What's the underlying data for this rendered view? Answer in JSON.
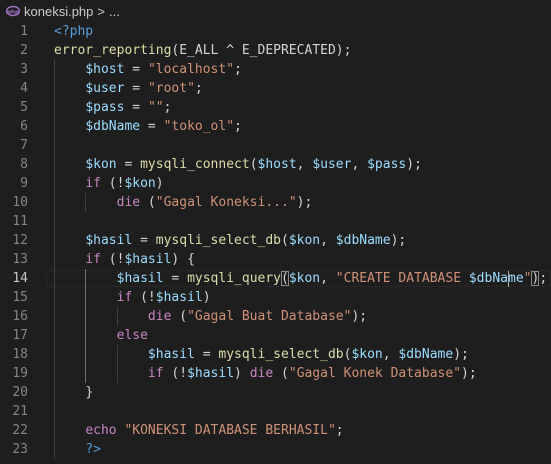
{
  "breadcrumb": {
    "file_name": "koneksi.php",
    "separator": ">",
    "ellipsis": "..."
  },
  "editor": {
    "current_line": 14,
    "lines": [
      {
        "num": "1",
        "tokens": [
          {
            "t": "<?php",
            "c": "kw"
          }
        ]
      },
      {
        "num": "2",
        "tokens": [
          {
            "t": "error_reporting",
            "c": "fn"
          },
          {
            "t": "(E_ALL ^ E_DEPRECATED);",
            "c": "plain"
          }
        ]
      },
      {
        "num": "3",
        "tokens": [
          {
            "t": "    ",
            "c": "plain"
          },
          {
            "t": "$host",
            "c": "var"
          },
          {
            "t": " = ",
            "c": "plain"
          },
          {
            "t": "\"localhost\"",
            "c": "str"
          },
          {
            "t": ";",
            "c": "plain"
          }
        ]
      },
      {
        "num": "4",
        "tokens": [
          {
            "t": "    ",
            "c": "plain"
          },
          {
            "t": "$user",
            "c": "var"
          },
          {
            "t": " = ",
            "c": "plain"
          },
          {
            "t": "\"root\"",
            "c": "str"
          },
          {
            "t": ";",
            "c": "plain"
          }
        ]
      },
      {
        "num": "5",
        "tokens": [
          {
            "t": "    ",
            "c": "plain"
          },
          {
            "t": "$pass",
            "c": "var"
          },
          {
            "t": " = ",
            "c": "plain"
          },
          {
            "t": "\"\"",
            "c": "str"
          },
          {
            "t": ";",
            "c": "plain"
          }
        ]
      },
      {
        "num": "6",
        "tokens": [
          {
            "t": "    ",
            "c": "plain"
          },
          {
            "t": "$dbName",
            "c": "var"
          },
          {
            "t": " = ",
            "c": "plain"
          },
          {
            "t": "\"toko_ol\"",
            "c": "str"
          },
          {
            "t": ";",
            "c": "plain"
          }
        ]
      },
      {
        "num": "7",
        "tokens": []
      },
      {
        "num": "8",
        "tokens": [
          {
            "t": "    ",
            "c": "plain"
          },
          {
            "t": "$kon",
            "c": "var"
          },
          {
            "t": " = ",
            "c": "plain"
          },
          {
            "t": "mysqli_connect",
            "c": "fn"
          },
          {
            "t": "(",
            "c": "plain"
          },
          {
            "t": "$host",
            "c": "var"
          },
          {
            "t": ", ",
            "c": "plain"
          },
          {
            "t": "$user",
            "c": "var"
          },
          {
            "t": ", ",
            "c": "plain"
          },
          {
            "t": "$pass",
            "c": "var"
          },
          {
            "t": ");",
            "c": "plain"
          }
        ]
      },
      {
        "num": "9",
        "tokens": [
          {
            "t": "    ",
            "c": "plain"
          },
          {
            "t": "if",
            "c": "ctl"
          },
          {
            "t": " (!",
            "c": "plain"
          },
          {
            "t": "$kon",
            "c": "var"
          },
          {
            "t": ")",
            "c": "plain"
          }
        ]
      },
      {
        "num": "10",
        "tokens": [
          {
            "t": "        ",
            "c": "plain"
          },
          {
            "t": "die",
            "c": "ctl"
          },
          {
            "t": " (",
            "c": "plain"
          },
          {
            "t": "\"Gagal Koneksi...\"",
            "c": "str"
          },
          {
            "t": ");",
            "c": "plain"
          }
        ]
      },
      {
        "num": "11",
        "tokens": []
      },
      {
        "num": "12",
        "tokens": [
          {
            "t": "    ",
            "c": "plain"
          },
          {
            "t": "$hasil",
            "c": "var"
          },
          {
            "t": " = ",
            "c": "plain"
          },
          {
            "t": "mysqli_select_db",
            "c": "fn"
          },
          {
            "t": "(",
            "c": "plain"
          },
          {
            "t": "$kon",
            "c": "var"
          },
          {
            "t": ", ",
            "c": "plain"
          },
          {
            "t": "$dbName",
            "c": "var"
          },
          {
            "t": ");",
            "c": "plain"
          }
        ]
      },
      {
        "num": "13",
        "tokens": [
          {
            "t": "    ",
            "c": "plain"
          },
          {
            "t": "if",
            "c": "ctl"
          },
          {
            "t": " (!",
            "c": "plain"
          },
          {
            "t": "$hasil",
            "c": "var"
          },
          {
            "t": ") {",
            "c": "plain"
          }
        ]
      },
      {
        "num": "14",
        "tokens": [
          {
            "t": "        ",
            "c": "plain"
          },
          {
            "t": "$hasil",
            "c": "var"
          },
          {
            "t": " = ",
            "c": "plain"
          },
          {
            "t": "mysqli_query",
            "c": "fn"
          },
          {
            "t": "(",
            "c": "plain",
            "b": 1
          },
          {
            "t": "$kon",
            "c": "var"
          },
          {
            "t": ", ",
            "c": "plain"
          },
          {
            "t": "\"CREATE DATABASE ",
            "c": "str"
          },
          {
            "t": "$dbNa",
            "c": "var"
          },
          {
            "t": "",
            "c": "cursor"
          },
          {
            "t": "me",
            "c": "var"
          },
          {
            "t": "\"",
            "c": "str"
          },
          {
            "t": ")",
            "c": "plain",
            "b": 1
          },
          {
            "t": ";",
            "c": "plain"
          }
        ]
      },
      {
        "num": "15",
        "tokens": [
          {
            "t": "        ",
            "c": "plain"
          },
          {
            "t": "if",
            "c": "ctl"
          },
          {
            "t": " (!",
            "c": "plain"
          },
          {
            "t": "$hasil",
            "c": "var"
          },
          {
            "t": ")",
            "c": "plain"
          }
        ]
      },
      {
        "num": "16",
        "tokens": [
          {
            "t": "            ",
            "c": "plain"
          },
          {
            "t": "die",
            "c": "ctl"
          },
          {
            "t": " (",
            "c": "plain"
          },
          {
            "t": "\"Gagal Buat Database\"",
            "c": "str"
          },
          {
            "t": ");",
            "c": "plain"
          }
        ]
      },
      {
        "num": "17",
        "tokens": [
          {
            "t": "        ",
            "c": "plain"
          },
          {
            "t": "else",
            "c": "ctl"
          }
        ]
      },
      {
        "num": "18",
        "tokens": [
          {
            "t": "            ",
            "c": "plain"
          },
          {
            "t": "$hasil",
            "c": "var"
          },
          {
            "t": " = ",
            "c": "plain"
          },
          {
            "t": "mysqli_select_db",
            "c": "fn"
          },
          {
            "t": "(",
            "c": "plain"
          },
          {
            "t": "$kon",
            "c": "var"
          },
          {
            "t": ", ",
            "c": "plain"
          },
          {
            "t": "$dbName",
            "c": "var"
          },
          {
            "t": ");",
            "c": "plain"
          }
        ]
      },
      {
        "num": "19",
        "tokens": [
          {
            "t": "            ",
            "c": "plain"
          },
          {
            "t": "if",
            "c": "ctl"
          },
          {
            "t": " (!",
            "c": "plain"
          },
          {
            "t": "$hasil",
            "c": "var"
          },
          {
            "t": ") ",
            "c": "plain"
          },
          {
            "t": "die",
            "c": "ctl"
          },
          {
            "t": " (",
            "c": "plain"
          },
          {
            "t": "\"Gagal Konek Database\"",
            "c": "str"
          },
          {
            "t": ");",
            "c": "plain"
          }
        ]
      },
      {
        "num": "20",
        "tokens": [
          {
            "t": "    ",
            "c": "plain"
          },
          {
            "t": "}",
            "c": "plain"
          }
        ]
      },
      {
        "num": "21",
        "tokens": []
      },
      {
        "num": "22",
        "tokens": [
          {
            "t": "    ",
            "c": "plain"
          },
          {
            "t": "echo",
            "c": "ctl"
          },
          {
            "t": " ",
            "c": "plain"
          },
          {
            "t": "\"KONEKSI DATABASE BERHASIL\"",
            "c": "str"
          },
          {
            "t": ";",
            "c": "plain"
          }
        ]
      },
      {
        "num": "23",
        "tokens": [
          {
            "t": "    ",
            "c": "plain"
          },
          {
            "t": "?>",
            "c": "kw"
          }
        ]
      }
    ]
  }
}
